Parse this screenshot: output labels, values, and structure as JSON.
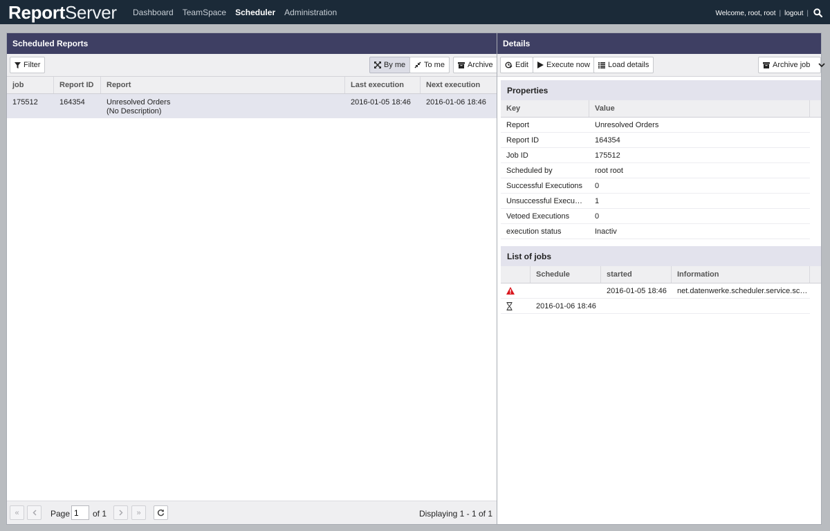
{
  "app": {
    "logo_bold": "Report",
    "logo_light": "Server"
  },
  "nav": {
    "items": [
      {
        "label": "Dashboard"
      },
      {
        "label": "TeamSpace"
      },
      {
        "label": "Scheduler"
      },
      {
        "label": "Administration"
      }
    ],
    "active": "Scheduler"
  },
  "user": {
    "welcome": "Welcome, root, root",
    "sep1": "|",
    "logout": "logout",
    "sep2": "|",
    "search_icon": "search-icon"
  },
  "left_panel": {
    "title": "Scheduled Reports",
    "toolbar": {
      "filter": "Filter",
      "by_me": "By me",
      "to_me": "To me",
      "archive": "Archive"
    },
    "columns": [
      "job",
      "Report ID",
      "Report",
      "Last execution",
      "Next execution"
    ],
    "rows": [
      {
        "job": "175512",
        "report_id": "164354",
        "report": "Unresolved Orders",
        "report_desc": "(No Description)",
        "last_execution": "2016-01-05 18:46",
        "next_execution": "2016-01-06 18:46"
      }
    ],
    "pager": {
      "page_label": "Page",
      "page_value": "1",
      "of": "of 1",
      "displaying": "Displaying 1 - 1 of 1"
    }
  },
  "right_panel": {
    "title": "Details",
    "toolbar": {
      "edit": "Edit",
      "execute_now": "Execute now",
      "load_details": "Load details",
      "archive_job": "Archive job"
    },
    "properties": {
      "title": "Properties",
      "key_header": "Key",
      "value_header": "Value",
      "rows": [
        {
          "key": "Report",
          "value": "Unresolved Orders"
        },
        {
          "key": "Report ID",
          "value": "164354"
        },
        {
          "key": "Job ID",
          "value": "175512"
        },
        {
          "key": "Scheduled by",
          "value": "root root"
        },
        {
          "key": "Successful Executions",
          "value": "0"
        },
        {
          "key": "Unsuccessful Executi…",
          "value": "1"
        },
        {
          "key": "Vetoed Executions",
          "value": "0"
        },
        {
          "key": "execution status",
          "value": "Inactiv"
        }
      ]
    },
    "jobs": {
      "title": "List of jobs",
      "columns": [
        "Schedule",
        "started",
        "Information"
      ],
      "rows": [
        {
          "icon": "warning-icon",
          "schedule": "",
          "started": "2016-01-05 18:46",
          "information": "net.datenwerke.scheduler.service.sch…"
        },
        {
          "icon": "hourglass-icon",
          "schedule": "2016-01-06 18:46",
          "started": "",
          "information": ""
        }
      ]
    }
  },
  "colors": {
    "topbar": "#1b2a38",
    "panel_header": "#3e3f63",
    "selected_row": "#e4e5ee",
    "section_header": "#e3e3ed",
    "warning": "#d9171e"
  }
}
